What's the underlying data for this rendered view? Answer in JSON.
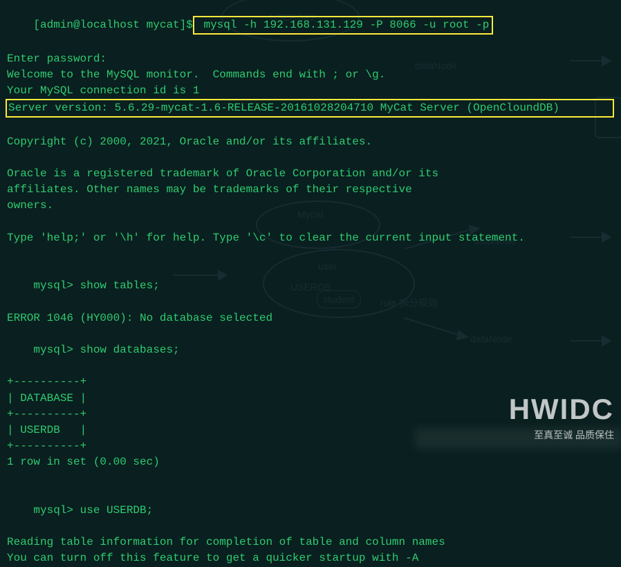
{
  "session": {
    "prompt_host": "[admin@localhost mycat]",
    "prompt_symbol": "$",
    "command1": " mysql -h 192.168.131.129 -P 8066 -u root -p",
    "enter_password": "Enter password:",
    "welcome": "Welcome to the MySQL monitor.  Commands end with ; or \\g.",
    "connection_id": "Your MySQL connection id is 1",
    "server_version": "Server version: 5.6.29-mycat-1.6-RELEASE-20161028204710 MyCat Server (OpenCloundDB)",
    "copyright": "Copyright (c) 2000, 2021, Oracle and/or its affiliates.",
    "trademark1": "Oracle is a registered trademark of Oracle Corporation and/or its",
    "trademark2": "affiliates. Other names may be trademarks of their respective",
    "trademark3": "owners.",
    "help_line": "Type 'help;' or '\\h' for help. Type '\\c' to clear the current input statement.",
    "mysql_prompt": "mysql>",
    "cmd_show_tables": " show tables;",
    "err_1046": "ERROR 1046 (HY000): No database selected",
    "cmd_show_databases": " show databases;",
    "table_border": "+----------+",
    "table_header": "| DATABASE |",
    "table_row1": "| USERDB   |",
    "rows_in_set": "1 row in set (0.00 sec)",
    "cmd_use_userdb": " use USERDB;",
    "reading_info": "Reading table information for completion of table and column names",
    "turn_off": "You can turn off this feature to get a quicker startup with -A"
  },
  "bg": {
    "userdb_label1": "USERDB2",
    "mycat_label": "Mycat",
    "user_label": "user",
    "userdb_label2": "USERDB",
    "student_label": "student",
    "rule_label": "rule 拆分规则",
    "datanode1": "dataNode",
    "datanode2": "dataNode",
    "datanode3": "dataNode"
  },
  "watermark": {
    "logo": "HWIDC",
    "tagline": "至真至诚 品质保住"
  }
}
